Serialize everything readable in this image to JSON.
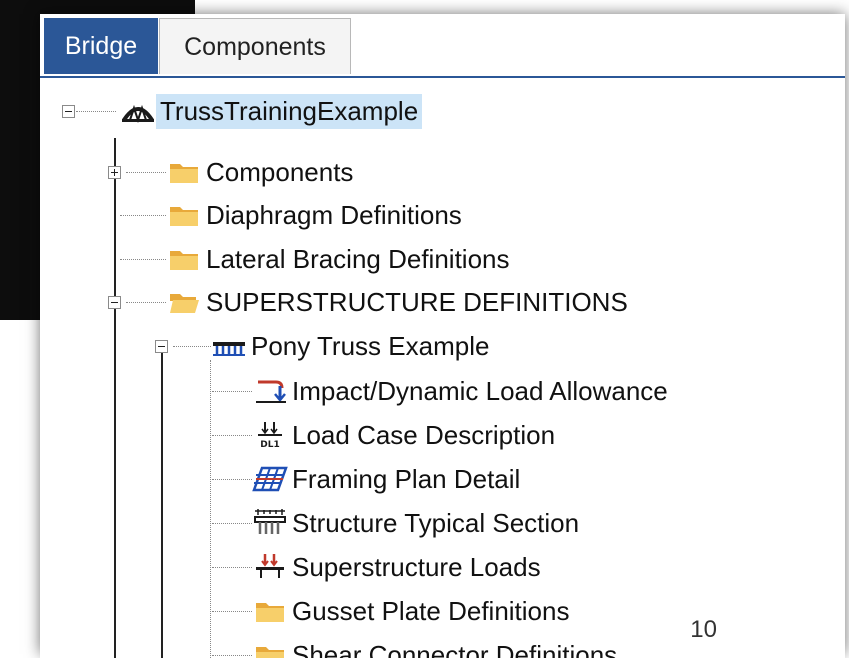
{
  "tabs": [
    {
      "label": "Bridge",
      "active": true
    },
    {
      "label": "Components",
      "active": false
    }
  ],
  "tree": {
    "root": {
      "label": "TrussTrainingExample",
      "selected": true,
      "icon": "truss-bridge-icon"
    },
    "items": [
      {
        "label": "Components",
        "icon": "folder-icon",
        "expander": "plus"
      },
      {
        "label": "Diaphragm Definitions",
        "icon": "folder-icon"
      },
      {
        "label": "Lateral Bracing Definitions",
        "icon": "folder-icon"
      },
      {
        "label": "SUPERSTRUCTURE DEFINITIONS",
        "icon": "folder-open-icon",
        "expander": "minus"
      },
      {
        "label": "Pony Truss Example",
        "icon": "pony-truss-icon",
        "expander": "minus"
      },
      {
        "label": "Impact/Dynamic Load Allowance",
        "icon": "impact-load-icon"
      },
      {
        "label": "Load Case Description",
        "icon": "load-case-icon"
      },
      {
        "label": "Framing Plan Detail",
        "icon": "framing-plan-icon"
      },
      {
        "label": "Structure Typical Section",
        "icon": "typical-section-icon"
      },
      {
        "label": "Superstructure Loads",
        "icon": "superstructure-loads-icon"
      },
      {
        "label": "Gusset Plate Definitions",
        "icon": "folder-icon"
      },
      {
        "label": "Shear Connector Definitions",
        "icon": "folder-icon"
      }
    ]
  },
  "page_number": "10",
  "colors": {
    "tab_active": "#2b5797",
    "selection": "#cce4f7",
    "folder": "#f2c14e"
  }
}
